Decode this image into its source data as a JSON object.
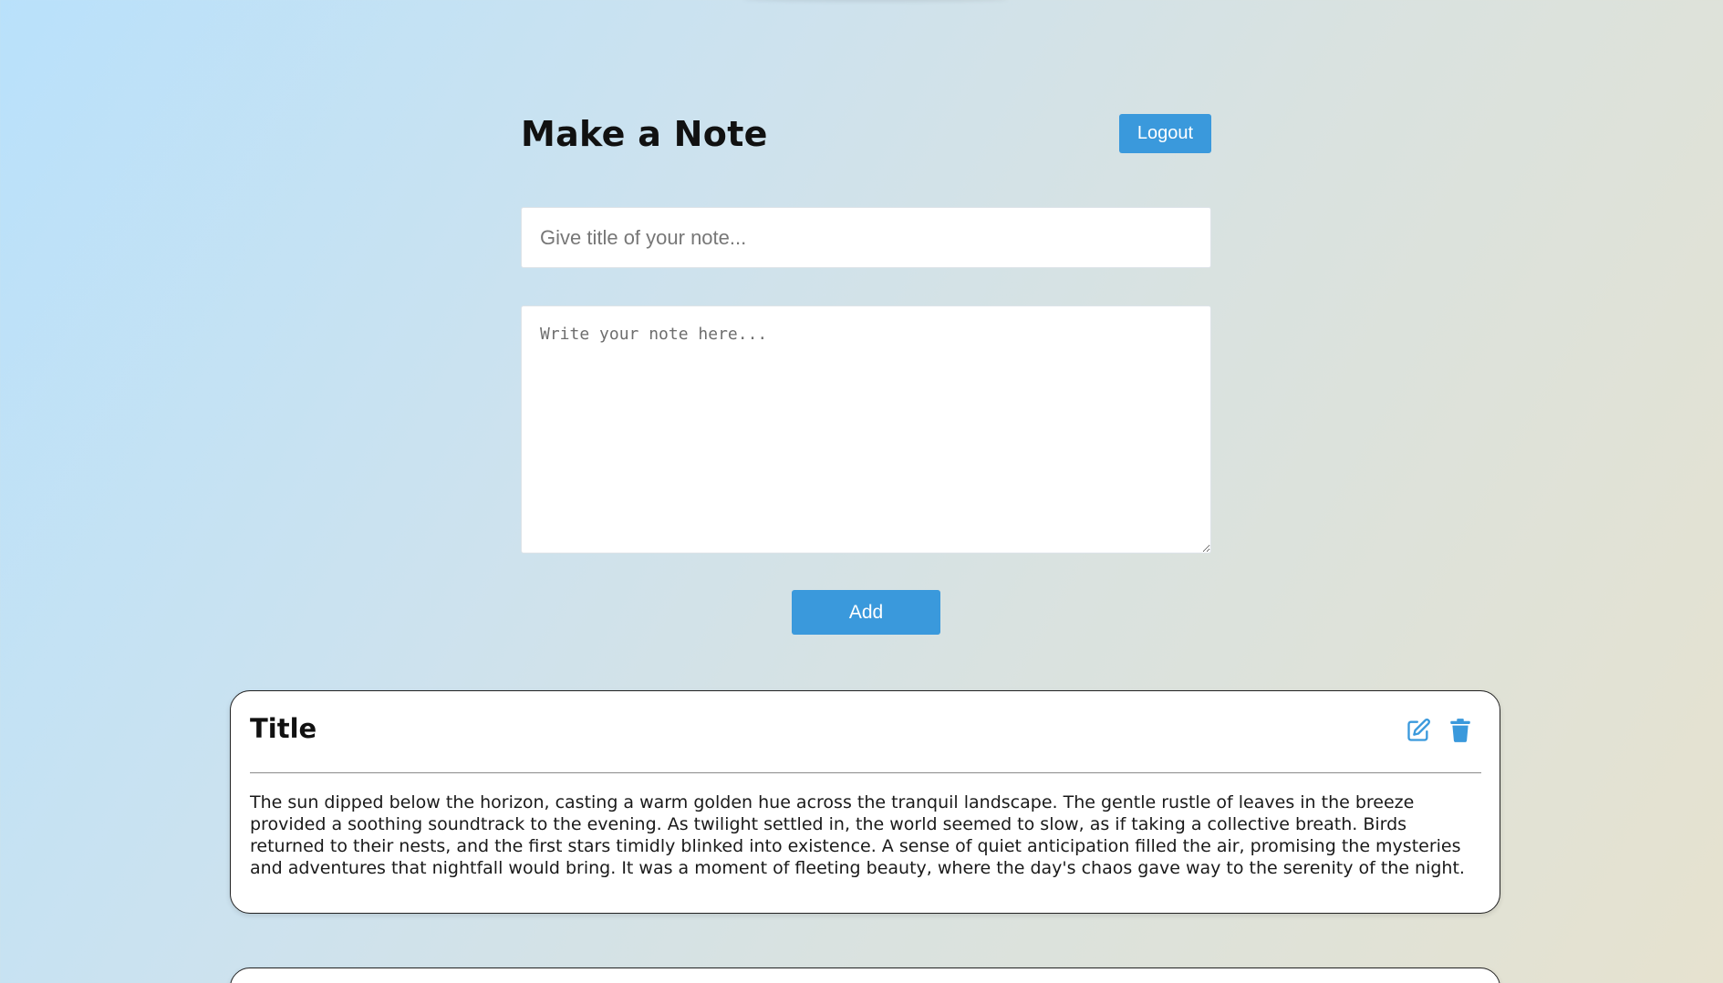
{
  "header": {
    "title": "Make a Note",
    "logout_label": "Logout"
  },
  "form": {
    "title_placeholder": "Give title of your note...",
    "title_value": "",
    "note_placeholder": "Write your note here...",
    "note_value": "",
    "add_label": "Add"
  },
  "notes": [
    {
      "title": "Title",
      "body": "The sun dipped below the horizon, casting a warm golden hue across the tranquil landscape. The gentle rustle of leaves in the breeze provided a soothing soundtrack to the evening. As twilight settled in, the world seemed to slow, as if taking a collective breath. Birds returned to their nests, and the first stars timidly blinked into existence. A sense of quiet anticipation filled the air, promising the mysteries and adventures that nightfall would bring. It was a moment of fleeting beauty, where the day's chaos gave way to the serenity of the night.",
      "actions": [
        "edit-icon",
        "trash-icon"
      ]
    }
  ],
  "colors": {
    "accent": "#3a99dc",
    "card_border": "#222222"
  }
}
